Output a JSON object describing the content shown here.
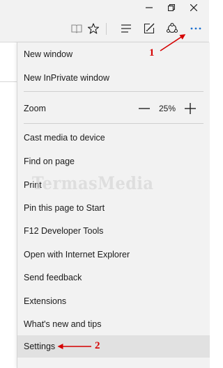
{
  "window_controls": {
    "minimize": "—",
    "restore": "⧉",
    "close": "✕"
  },
  "toolbar": {
    "icons": [
      "reading-view-icon",
      "favorites-star-icon",
      "hub-icon",
      "web-note-icon",
      "share-icon",
      "more-actions-icon"
    ]
  },
  "menu": {
    "new_window": "New window",
    "new_inprivate": "New InPrivate window",
    "zoom_label": "Zoom",
    "zoom_value": "25%",
    "cast": "Cast media to device",
    "find": "Find on page",
    "print": "Print",
    "pin": "Pin this page to Start",
    "f12": "F12 Developer Tools",
    "open_ie": "Open with Internet Explorer",
    "feedback": "Send feedback",
    "extensions": "Extensions",
    "whats_new": "What's new and tips",
    "settings": "Settings"
  },
  "annotations": {
    "step1": "1",
    "step2": "2",
    "color": "#d50000"
  },
  "watermark": "TermasMedia",
  "colors": {
    "menu_bg": "#f2f2f2",
    "hover_bg": "#e1e1e1",
    "annotation_red": "#d50000"
  }
}
